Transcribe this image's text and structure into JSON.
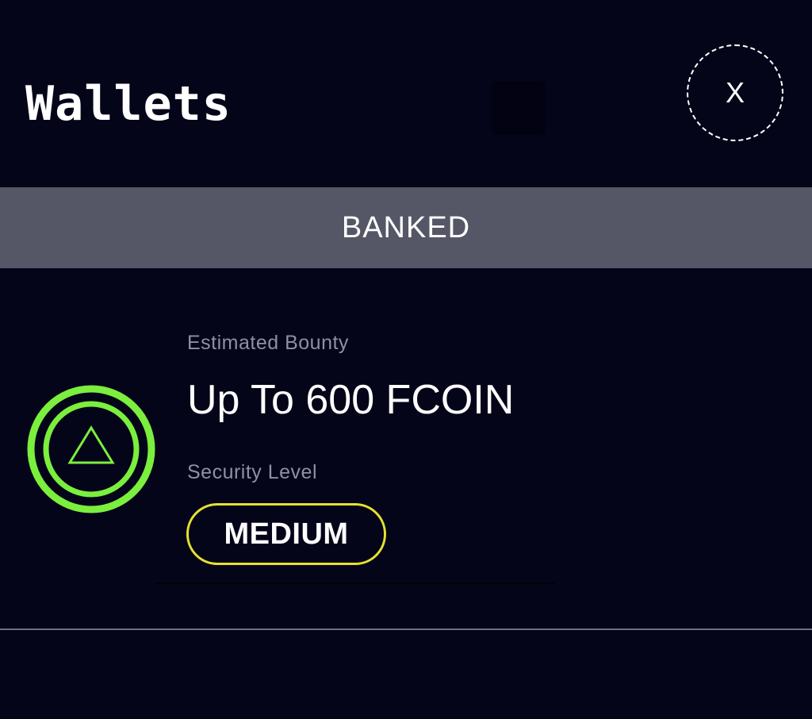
{
  "header": {
    "title": "Wallets",
    "close_label": "X"
  },
  "banner": {
    "label": "BANKED"
  },
  "wallet_card": {
    "bounty_label": "Estimated Bounty",
    "bounty_value": "Up To 600 FCOIN",
    "security_label": "Security Level",
    "security_level": "MEDIUM",
    "icon": "triangle-icon"
  },
  "colors": {
    "background": "#05051a",
    "banner": "#555766",
    "ring_accent": "#7bef3d",
    "badge_border": "#e6e12e",
    "muted_text": "#8f90a0"
  }
}
